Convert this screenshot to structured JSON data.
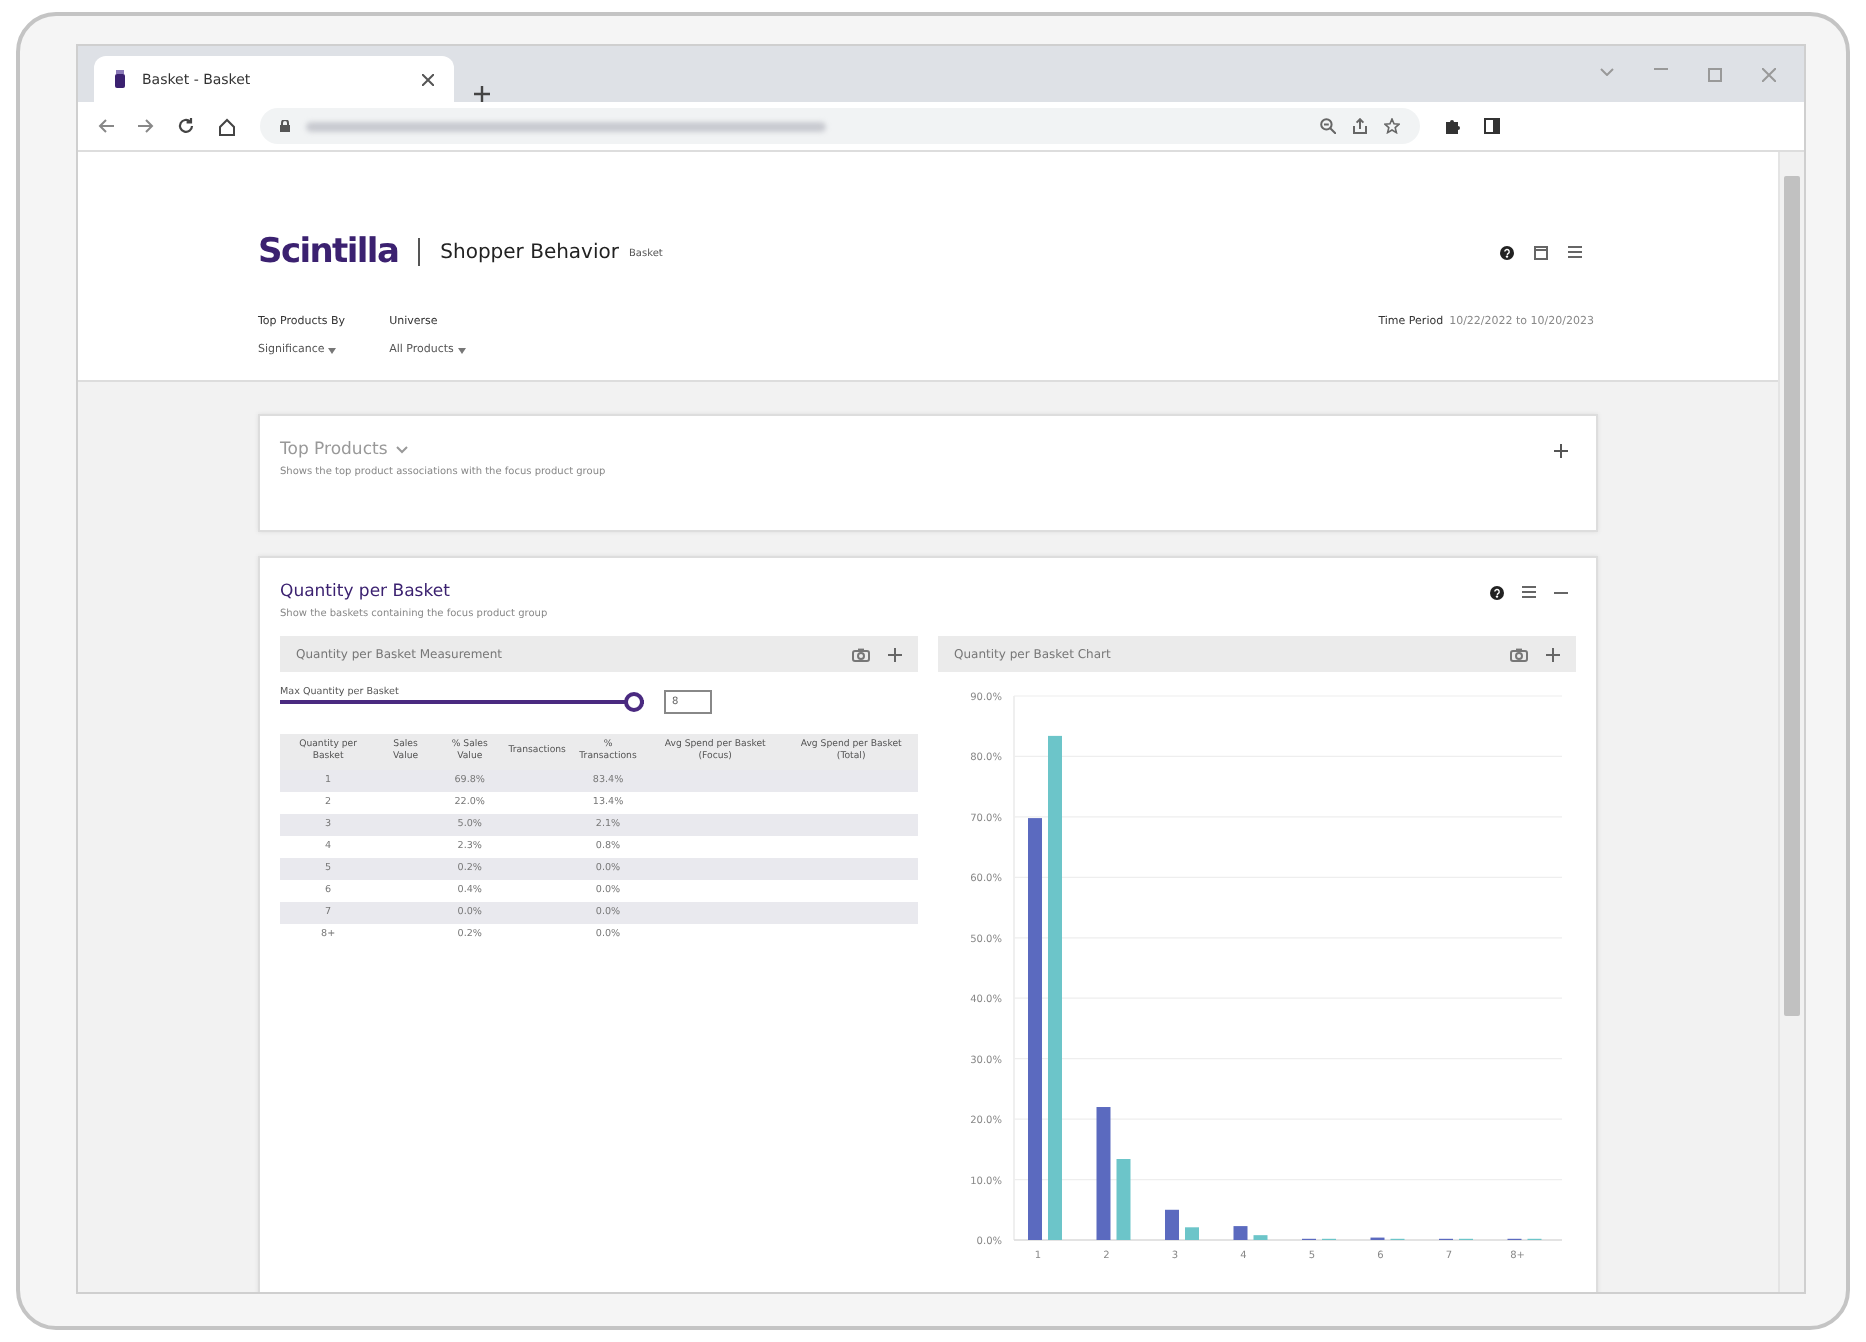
{
  "browser": {
    "tab_title": "Basket - Basket"
  },
  "app": {
    "logo": "Scintilla",
    "title": "Shopper Behavior",
    "subtitle": "Basket",
    "filters": [
      {
        "label": "Top Products By",
        "value": "Significance"
      },
      {
        "label": "Universe",
        "value": "All Products"
      }
    ],
    "time_period": {
      "label": "Time Period",
      "value": "10/22/2022 to 10/20/2023"
    }
  },
  "cards": [
    {
      "title": "Top Products",
      "description": "Shows the top product associations with the focus product group",
      "expanded": false
    },
    {
      "title": "Quantity per Basket",
      "description": "Show the baskets containing the focus product group",
      "expanded": true,
      "measurement": {
        "title": "Quantity per Basket Measurement",
        "slider_label": "Max Quantity per Basket",
        "slider": {
          "level": 1.0
        },
        "input_value": "8",
        "table": {
          "columns": [
            "Quantity per Basket",
            "Sales Value",
            "% Sales Value",
            "Transactions",
            "% Transactions",
            "Avg Spend per Basket (Focus)",
            "Avg Spend per Basket (Total)"
          ],
          "rows": [
            {
              "quantity": "1",
              "pct_sales_value": "69.8%",
              "pct_transactions": "83.4%"
            },
            {
              "quantity": "2",
              "pct_sales_value": "22.0%",
              "pct_transactions": "13.4%"
            },
            {
              "quantity": "3",
              "pct_sales_value": "5.0%",
              "pct_transactions": "2.1%"
            },
            {
              "quantity": "4",
              "pct_sales_value": "2.3%",
              "pct_transactions": "0.8%"
            },
            {
              "quantity": "5",
              "pct_sales_value": "0.2%",
              "pct_transactions": "0.0%"
            },
            {
              "quantity": "6",
              "pct_sales_value": "0.4%",
              "pct_transactions": "0.0%"
            },
            {
              "quantity": "7",
              "pct_sales_value": "0.0%",
              "pct_transactions": "0.0%"
            },
            {
              "quantity": "8+",
              "pct_sales_value": "0.2%",
              "pct_transactions": "0.0%"
            }
          ]
        }
      },
      "chart_panel": {
        "title": "Quantity per Basket Chart",
        "chart_data": {
          "type": "bar",
          "grid": true,
          "categories": [
            "1",
            "2",
            "3",
            "4",
            "5",
            "6",
            "7",
            "8+"
          ],
          "series": [
            {
              "color": "#5b6abf",
              "values": [
                69.8,
                22.0,
                5.0,
                2.3,
                0.2,
                0.4,
                0.0,
                0.2
              ]
            },
            {
              "color": "#6cc5c9",
              "values": [
                83.4,
                13.4,
                2.1,
                0.8,
                0.0,
                0.0,
                0.0,
                0.0
              ]
            }
          ],
          "ylim": [
            0,
            90
          ],
          "yticks": [
            {
              "value": 0,
              "label": "0.0%"
            },
            {
              "value": 10,
              "label": "10.0%"
            },
            {
              "value": 20,
              "label": "20.0%"
            },
            {
              "value": 30,
              "label": "30.0%"
            },
            {
              "value": 40,
              "label": "40.0%"
            },
            {
              "value": 50,
              "label": "50.0%"
            },
            {
              "value": 60,
              "label": "60.0%"
            },
            {
              "value": 70,
              "label": "70.0%"
            },
            {
              "value": 80,
              "label": "80.0%"
            },
            {
              "value": 90,
              "label": "90.0%"
            }
          ]
        }
      }
    }
  ]
}
